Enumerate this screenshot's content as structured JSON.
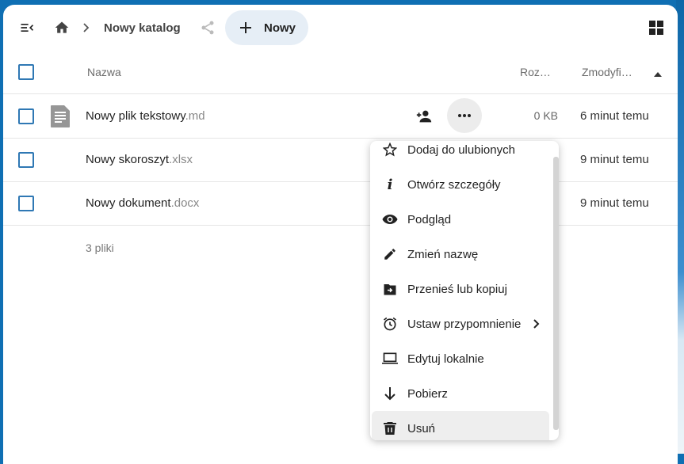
{
  "topbar": {
    "menu_icon": "menu-collapse-icon",
    "home_icon": "home-icon",
    "separator_icon": "chevron-right-icon",
    "breadcrumb_current": "Nowy katalog",
    "share_icon": "share-icon",
    "new_button_label": "Nowy",
    "grid_icon": "grid-view-icon"
  },
  "table": {
    "columns": {
      "name": "Nazwa",
      "size": "Roz…",
      "modified": "Zmodyfi…"
    },
    "sort_icon": "sort-ascending-icon",
    "rows": [
      {
        "base": "Nowy plik tekstowy",
        "ext": ".md",
        "size": "0 KB",
        "modified": "6 minut temu",
        "icon": "text-file-icon"
      },
      {
        "base": "Nowy skoroszyt",
        "ext": ".xlsx",
        "size": "",
        "modified": "9 minut temu",
        "icon": ""
      },
      {
        "base": "Nowy dokument",
        "ext": ".docx",
        "size": "",
        "modified": "9 minut temu",
        "icon": ""
      }
    ],
    "summary": "3 pliki"
  },
  "context_menu": {
    "items": [
      {
        "label": "Dodaj do ulubionych",
        "icon": "star-outline-icon"
      },
      {
        "label": "Otwórz szczegóły",
        "icon": "info-icon"
      },
      {
        "label": "Podgląd",
        "icon": "eye-icon"
      },
      {
        "label": "Zmień nazwę",
        "icon": "pencil-icon"
      },
      {
        "label": "Przenieś lub kopiuj",
        "icon": "folder-move-icon"
      },
      {
        "label": "Ustaw przypomnienie",
        "icon": "alarm-clock-icon",
        "submenu": true
      },
      {
        "label": "Edytuj lokalnie",
        "icon": "laptop-icon"
      },
      {
        "label": "Pobierz",
        "icon": "download-arrow-icon"
      },
      {
        "label": "Usuń",
        "icon": "trash-icon",
        "highlighted": true
      }
    ]
  },
  "colors": {
    "accent": "#2f78b4",
    "background": "#0f6fb3",
    "new_button": "#e6eef6"
  }
}
